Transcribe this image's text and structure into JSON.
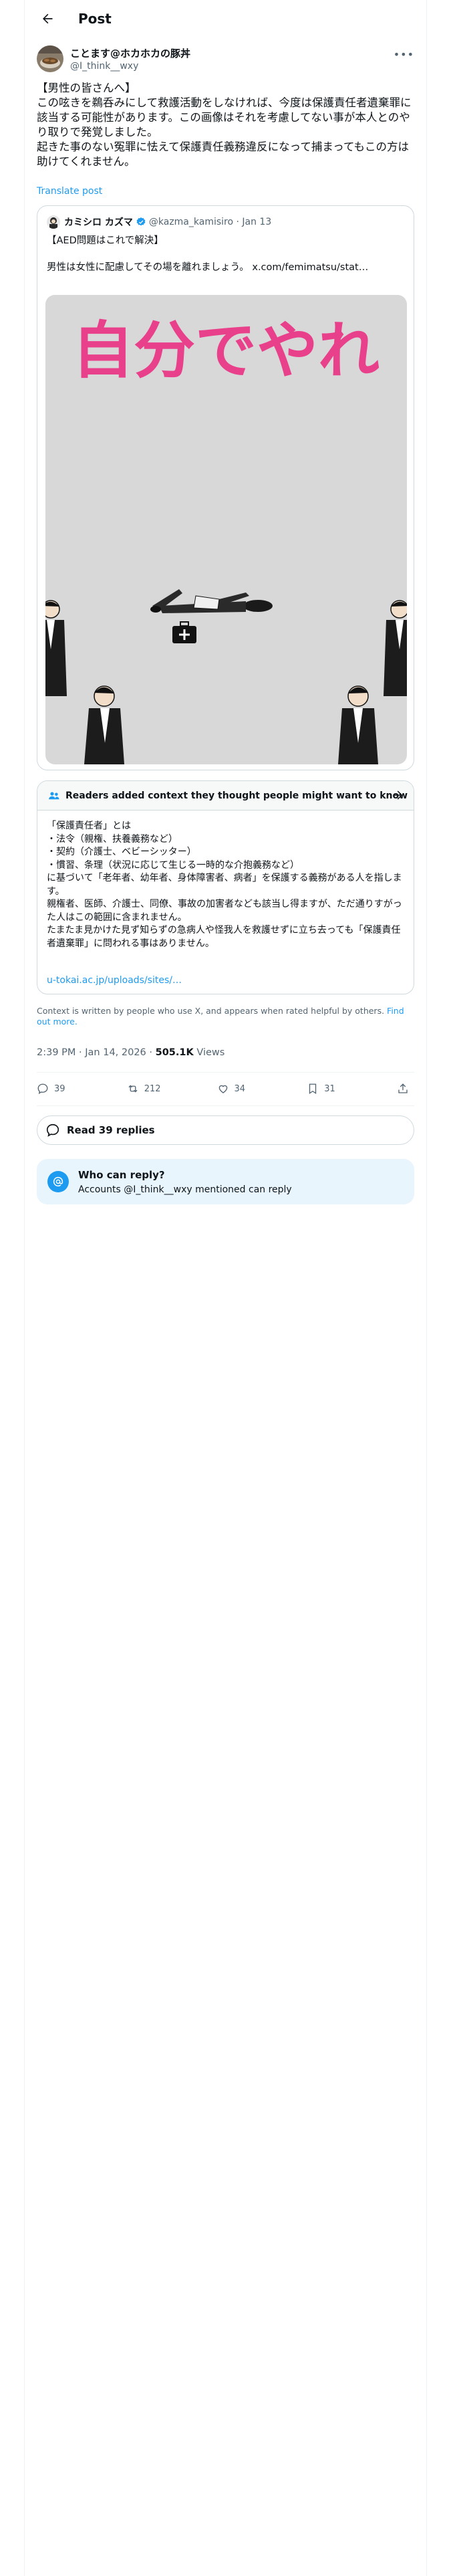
{
  "header": {
    "title": "Post"
  },
  "post": {
    "author_name": "ことます@ホカホカの豚丼",
    "author_handle": "@I_think__wxy",
    "text": "【男性の皆さんへ】\nこの呟きを鵜呑みにして救護活動をしなければ、今度は保護責任者遺棄罪に該当する可能性があります。この画像はそれを考慮してない事が本人とのやり取りで発覚しました。\n起きた事のない冤罪に怯えて保護責任義務違反になって捕まってもこの方は助けてくれません。",
    "translate_label": "Translate post"
  },
  "quote": {
    "author_name": "カミシロ カズマ",
    "author_handle": "@kazma_kamisiro · Jan 13",
    "text": "【AED問題はこれで解決】\n\n男性は女性に配慮してその場を離れましょう。 x.com/femimatsu/stat…",
    "image_caption": "自分でやれ"
  },
  "community_note": {
    "title": "Readers added context they thought people might want to know",
    "body": "「保護責任者」とは\n・法令（親権、扶養義務など）\n・契約（介護士、ベビーシッター）\n・慣習、条理（状況に応じて生じる一時的な介抱義務など）\nに基づいて「老年者、幼年者、身体障害者、病者」を保護する義務がある人を指します。\n親権者、医師、介護士、同僚、事故の加害者なども該当し得ますが、ただ通りすがった人はこの範囲に含まれません。\nたまたま見かけた見ず知らずの急病人や怪我人を救護せずに立ち去っても「保護責任者遺棄罪」に問われる事はありません。",
    "link": "u-tokai.ac.jp/uploads/sites/…",
    "footer_text": "Context is written by people who use X, and appears when rated helpful by others.",
    "footer_link": "Find out more."
  },
  "meta": {
    "timestamp": "2:39 PM · Jan 14, 2026 · ",
    "views_count": "505.1K",
    "views_label": " Views"
  },
  "actions": {
    "replies": "39",
    "reposts": "212",
    "likes": "34",
    "bookmarks": "31"
  },
  "read_replies": "Read 39 replies",
  "who_can_reply": {
    "title": "Who can reply?",
    "subtitle": "Accounts @I_think__wxy mentioned can reply"
  },
  "colors": {
    "accent": "#1d9bf0",
    "caption_pink": "#e8408a",
    "border": "#cfd9de",
    "muted": "#536471"
  }
}
